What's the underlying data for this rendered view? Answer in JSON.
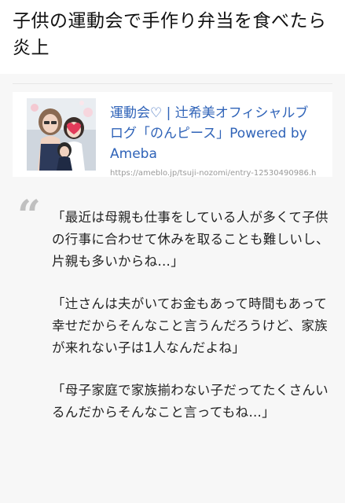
{
  "article": {
    "title": "子供の運動会で手作り弁当を食べたら炎上"
  },
  "link_card": {
    "title": "運動会♡ | 辻希美オフィシャルブログ「のんピース」Powered by Ameba",
    "url": "https://ameblo.jp/tsuji-nozomi/entry-12530490986.html"
  },
  "quote": {
    "mark": "“",
    "paragraphs": [
      "「最近は母親も仕事をしている人が多くて子供の行事に合わせて休みを取ることも難しいし、片親も多いからね…」",
      "「辻さんは夫がいてお金もあって時間もあって幸せだからそんなこと言うんだろうけど、家族が来れない子は1人なんだよね」",
      "「母子家庭で家族揃わない子だってたくさんいるんだからそんなこと言ってもね…」"
    ]
  },
  "colors": {
    "link": "#2f63b8",
    "quote_mark": "#c0c0c0",
    "background": "#f7f7f7"
  }
}
